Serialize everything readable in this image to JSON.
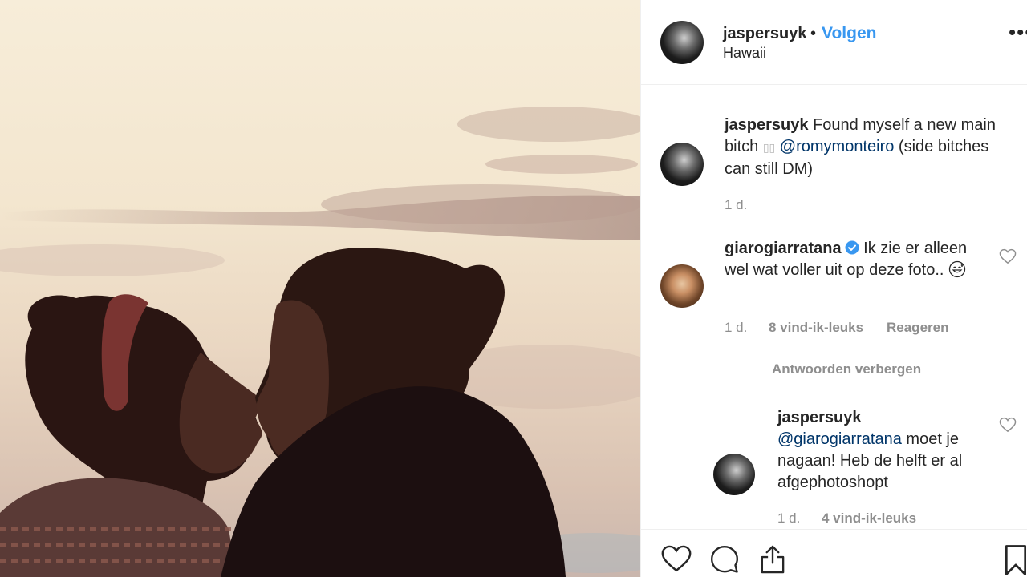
{
  "post": {
    "username": "jaspersuyk",
    "separator": "•",
    "follow_label": "Volgen",
    "location": "Hawaii",
    "more_label": "•••"
  },
  "caption": {
    "username": "jaspersuyk",
    "text_before": "Found myself a new main bitch",
    "mention": "@romymonteiro",
    "text_after": "(side bitches can still DM)",
    "time": "1 d."
  },
  "comments": [
    {
      "username": "giarogiarratana",
      "verified": true,
      "text": "Ik zie er alleen wel wat voller uit op deze foto..",
      "emoji": "grinning-sweat-face",
      "time": "1 d.",
      "likes": "8 vind-ik-leuks",
      "reply_label": "Reageren"
    }
  ],
  "replies_toggle": "Antwoorden verbergen",
  "reply": {
    "username": "jaspersuyk",
    "mention": "@giarogiarratana",
    "text": "moet je nagaan! Heb de helft er al afgephotoshopt",
    "time": "1 d.",
    "likes": "4 vind-ik-leuks"
  },
  "icons": [
    "heart-icon",
    "comment-icon",
    "share-icon",
    "bookmark-icon",
    "more-icon",
    "verified-icon"
  ],
  "colors": {
    "link": "#3897f0",
    "mention": "#003569",
    "muted": "#8e8e8e",
    "text": "#262626"
  }
}
